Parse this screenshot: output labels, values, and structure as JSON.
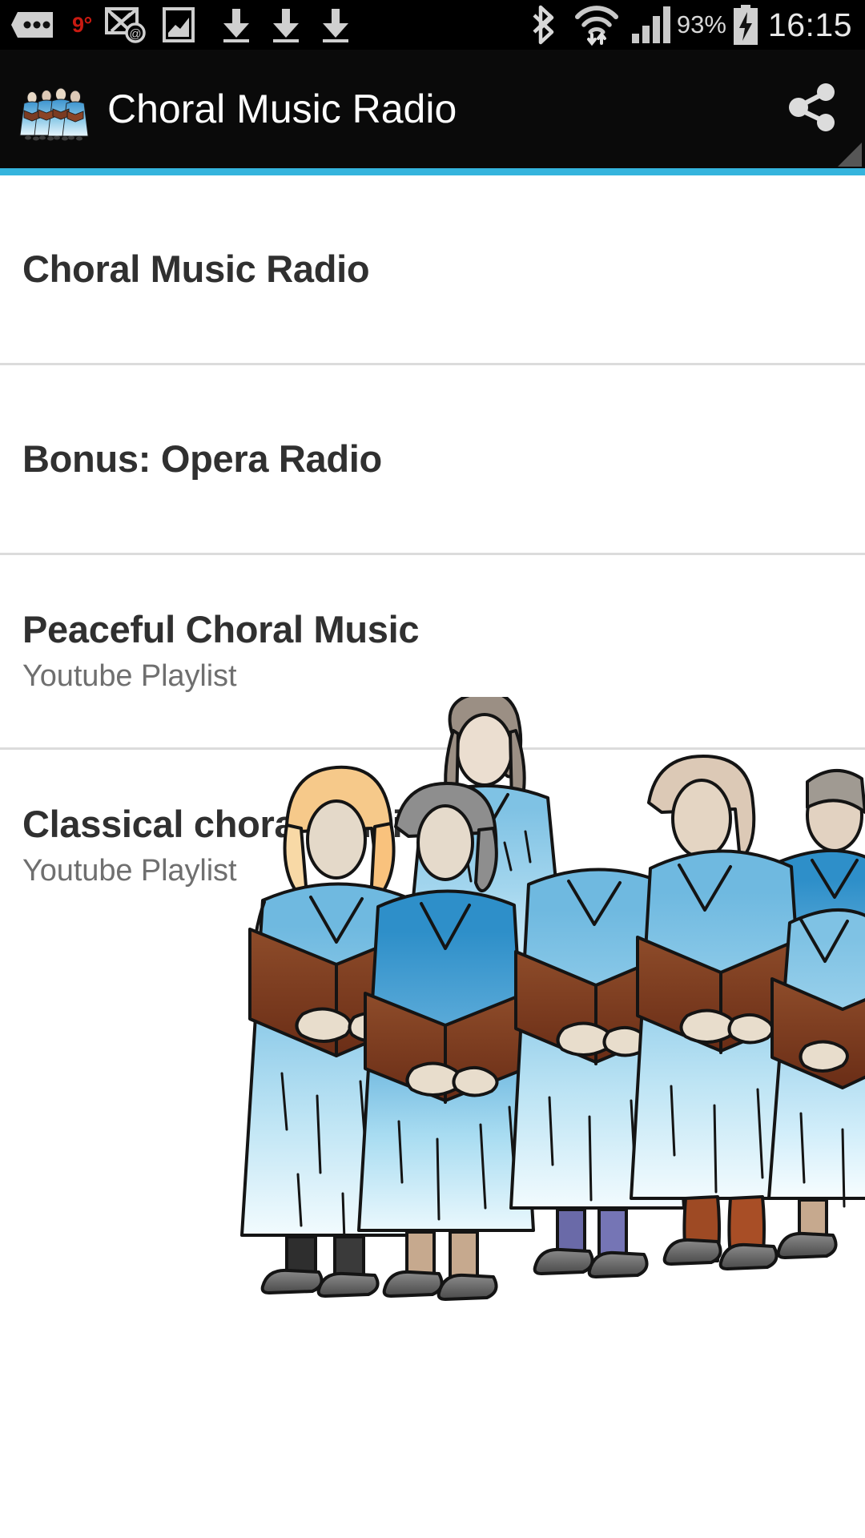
{
  "status_bar": {
    "temperature": "9°",
    "battery_percent": "93%",
    "time": "16:15",
    "icons": [
      "more-dots-icon",
      "email-sync-icon",
      "screenshot-image-icon",
      "download-icon",
      "download-icon",
      "download-icon",
      "bluetooth-icon",
      "wifi-icon",
      "cellular-signal-icon",
      "battery-charging-icon"
    ]
  },
  "app_bar": {
    "title": "Choral Music Radio",
    "app_icon": "choir-app-icon",
    "share_icon": "share-icon",
    "resize_handle": "resize-handle-icon"
  },
  "theme": {
    "accent": "#35b4dd",
    "app_bar_bg": "#0a0a0a",
    "status_bar_bg": "#000000",
    "page_bg": "#ffffff",
    "title_color": "#303030",
    "subtitle_color": "#6f6f6f",
    "divider_color": "#dcdcdc"
  },
  "list": {
    "items": [
      {
        "title": "Choral Music Radio",
        "subtitle": ""
      },
      {
        "title": "Bonus: Opera Radio",
        "subtitle": ""
      },
      {
        "title": "Peaceful Choral Music",
        "subtitle": "Youtube Playlist"
      },
      {
        "title": "Classical choral music",
        "subtitle": "Youtube Playlist"
      }
    ]
  },
  "hero": {
    "name": "choir-illustration",
    "description": "Clipart of a choir of singers in light blue robes holding brown hymn books"
  }
}
